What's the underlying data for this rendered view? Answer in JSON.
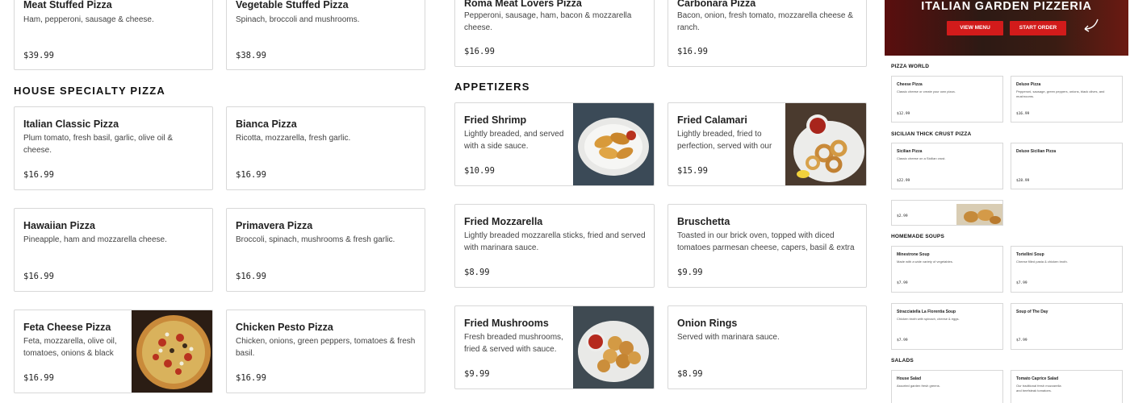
{
  "colors": {
    "accent_red": "#d21b1b",
    "card_border": "#d8d8d8",
    "text_dark": "#222222"
  },
  "top_partial": [
    {
      "name": "Meat Stuffed Pizza",
      "desc": "Ham, pepperoni, sausage & cheese.",
      "price": "$39.99"
    },
    {
      "name": "Vegetable Stuffed Pizza",
      "desc": "Spinach, broccoli and mushrooms.",
      "price": "$38.99"
    },
    {
      "name": "Roma Meat Lovers Pizza",
      "desc": "Pepperoni, sausage, ham, bacon & mozzarella cheese.",
      "price": "$16.99"
    },
    {
      "name": "Carbonara Pizza",
      "desc": "Bacon, onion, fresh tomato, mozzarella cheese & ranch.",
      "price": "$16.99"
    }
  ],
  "house_specialty": {
    "title": "HOUSE SPECIALTY PIZZA",
    "items": [
      {
        "name": "Italian Classic Pizza",
        "desc": "Plum tomato, fresh basil, garlic, olive oil & cheese.",
        "price": "$16.99"
      },
      {
        "name": "Bianca Pizza",
        "desc": "Ricotta, mozzarella, fresh garlic.",
        "price": "$16.99"
      },
      {
        "name": "Hawaiian Pizza",
        "desc": "Pineapple, ham and mozzarella cheese.",
        "price": "$16.99"
      },
      {
        "name": "Primavera Pizza",
        "desc": "Broccoli, spinach, mushrooms & fresh garlic.",
        "price": "$16.99"
      },
      {
        "name": "Feta Cheese Pizza",
        "desc": "Feta, mozzarella, olive oil, tomatoes, onions & black olives.",
        "price": "$16.99"
      },
      {
        "name": "Chicken Pesto Pizza",
        "desc": "Chicken, onions, green peppers, tomatoes & fresh basil.",
        "price": "$16.99"
      }
    ]
  },
  "appetizers": {
    "title": "APPETIZERS",
    "items": [
      {
        "name": "Fried Shrimp",
        "desc": "Lightly breaded, and served with a side sauce.",
        "price": "$10.99"
      },
      {
        "name": "Fried Calamari",
        "desc": "Lightly breaded, fried to perfection, served with our marinara sauce.",
        "price": "$15.99"
      },
      {
        "name": "Fried Mozzarella",
        "desc": "Lightly breaded mozzarella sticks, fried and served with marinara sauce.",
        "price": "$8.99"
      },
      {
        "name": "Bruschetta",
        "desc": "Toasted in our brick oven, topped with diced tomatoes parmesan cheese, capers, basil & extra virgin olive oil.",
        "price": "$9.99"
      },
      {
        "name": "Fried Mushrooms",
        "desc": "Fresh breaded mushrooms, fried & served with sauce.",
        "price": "$9.99"
      },
      {
        "name": "Onion Rings",
        "desc": "Served with marinara sauce.",
        "price": "$8.99"
      }
    ]
  },
  "preview": {
    "hero_title": "ITALIAN GARDEN PIZZERIA",
    "view_menu": "VIEW MENU",
    "start_order": "START ORDER",
    "pizza_world": "PIZZA WORLD",
    "pizza_items": [
      {
        "name": "Cheese Pizza",
        "desc": "Classic cheese or create your own pizza.",
        "price": "$12.99"
      },
      {
        "name": "Deluxe Pizza",
        "desc": "Pepperoni, sausage, green peppers, onions, black olives, and mushrooms.",
        "price": "$16.99"
      }
    ],
    "sicilian_title": "SICILIAN THICK CRUST PIZZA",
    "sicilian_items": [
      {
        "name": "Sicilian Pizza",
        "desc": "Classic cheese on a Sicilian crust.",
        "price": "$22.99"
      },
      {
        "name": "Deluxe Sicilian Pizza",
        "desc": "",
        "price": "$28.99"
      }
    ],
    "partial_price": "$2.99",
    "soups_title": "HOMEMADE SOUPS",
    "soup_items": [
      {
        "name": "Minestrone Soup",
        "desc": "Made with a wide variety of vegetables.",
        "price": "$7.99"
      },
      {
        "name": "Tortellini Soup",
        "desc": "Cheese filled pasta & chicken broth.",
        "price": "$7.99"
      },
      {
        "name": "Stracciatella La Florentia Soup",
        "desc": "Chicken broth with spinach, cheese & eggs.",
        "price": "$7.99"
      },
      {
        "name": "Soup of The Day",
        "desc": "",
        "price": "$7.99"
      }
    ],
    "salads_title": "SALADS",
    "salad_items": [
      {
        "name": "House Salad",
        "desc": "Assorted garden fresh greens.",
        "price": ""
      },
      {
        "name": "Tomato Caprice Salad",
        "desc": "Our traditional fresh mozzarella and beefsteak tomatoes.",
        "price": ""
      }
    ]
  }
}
